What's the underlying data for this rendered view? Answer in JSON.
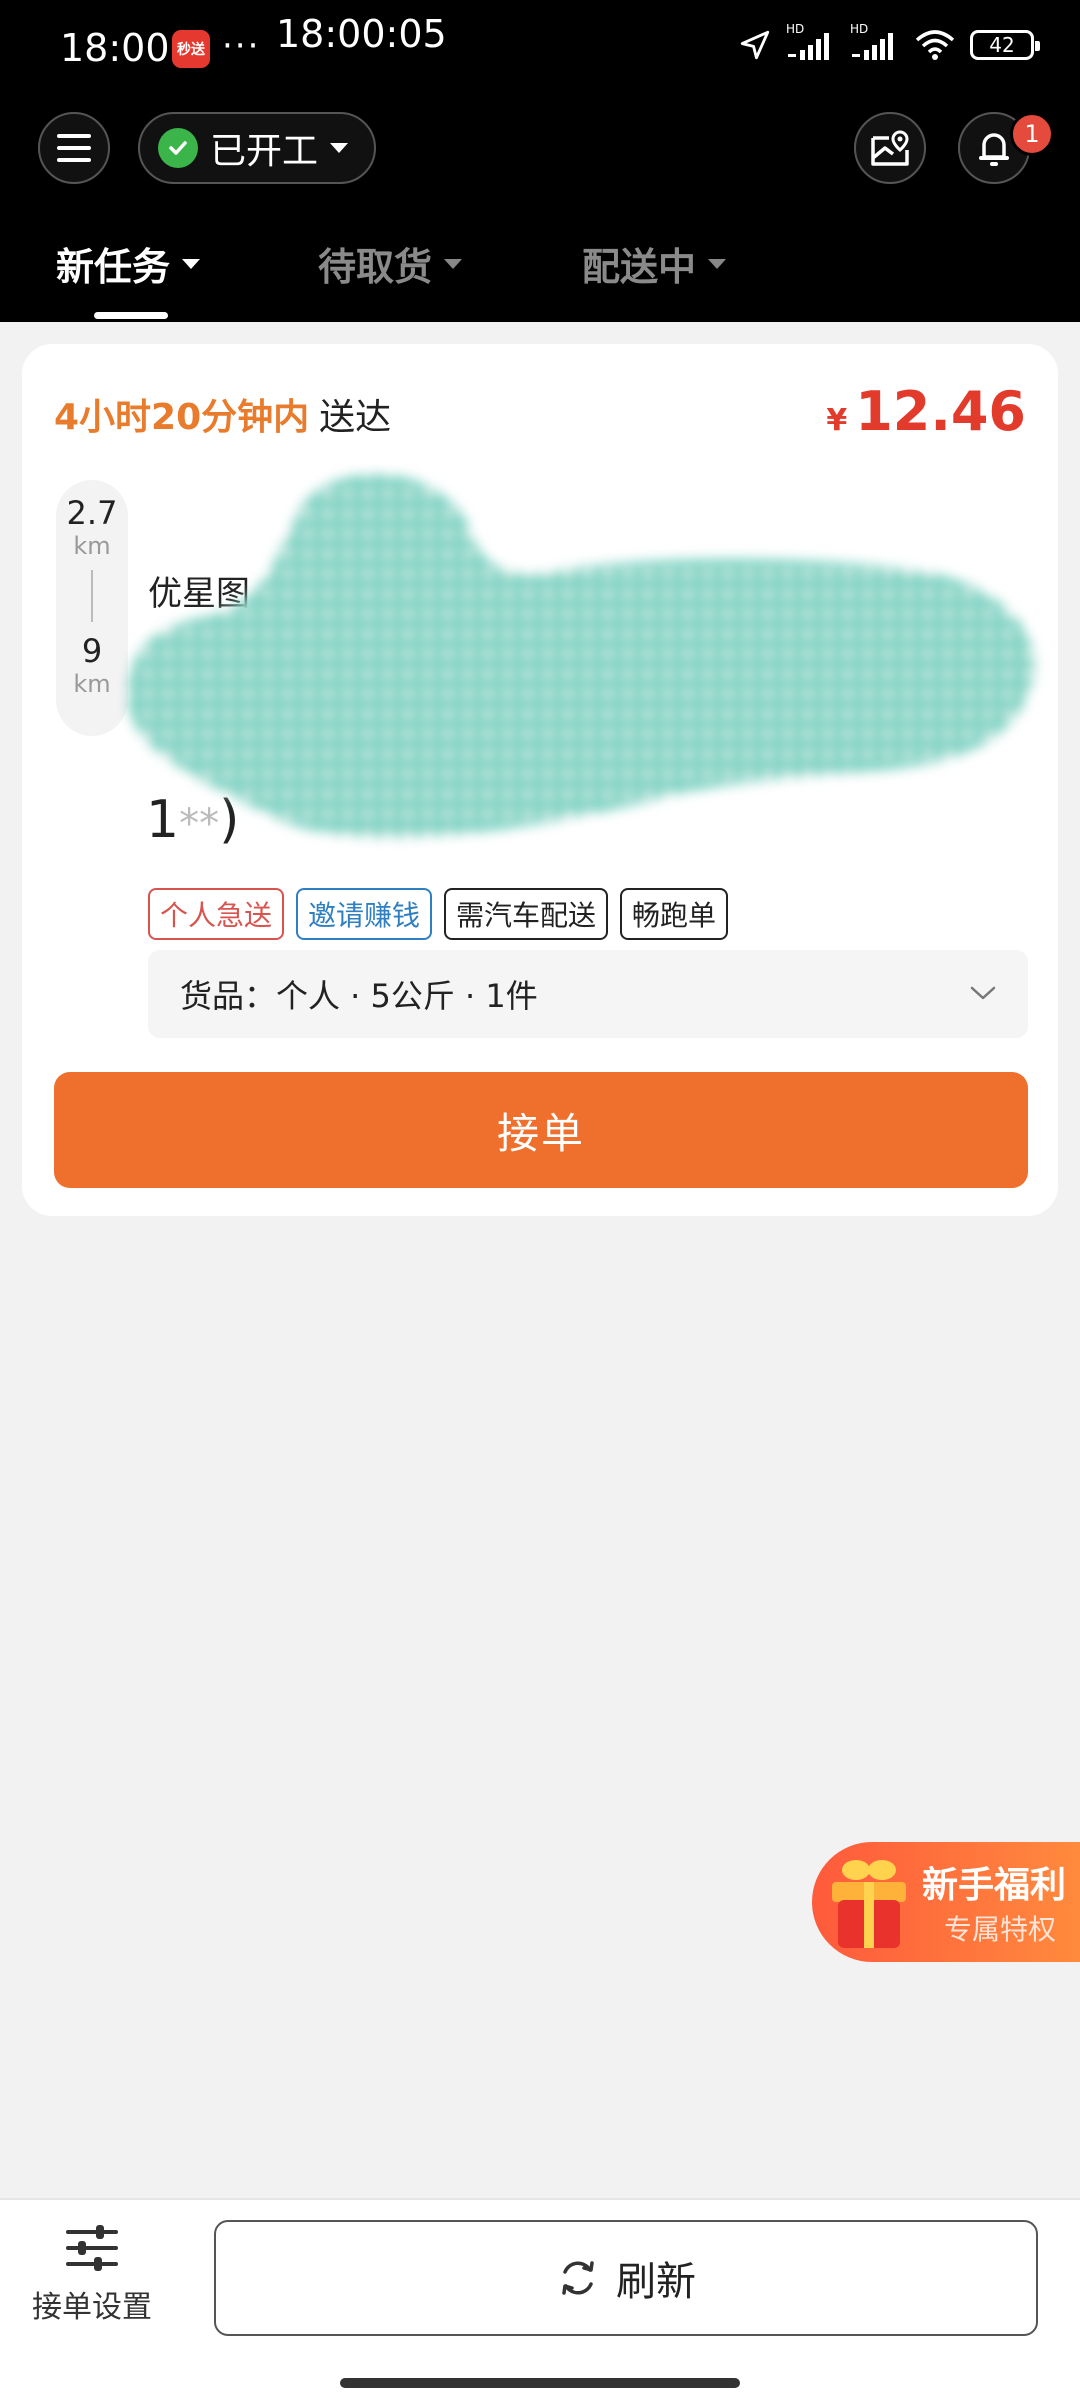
{
  "status_bar": {
    "time": "18:00",
    "app_badge": "秒送",
    "dots": "···",
    "clock": "18:00:05",
    "signal1": "HD",
    "signal2": "HD",
    "battery": "42"
  },
  "header": {
    "work_status": "已开工",
    "notification_count": "1"
  },
  "tabs": [
    {
      "label": "新任务"
    },
    {
      "label": "待取货"
    },
    {
      "label": "配送中"
    }
  ],
  "order": {
    "eta_time": "4小时20分钟内",
    "eta_label": "送达",
    "price_currency": "¥",
    "price": "12.46",
    "pickup_distance": "2.7",
    "pickup_unit": "km",
    "delivery_distance": "9",
    "delivery_unit": "km",
    "pickup_address": "优星图",
    "phone_prefix": "1",
    "phone_mask": "**",
    "phone_suffix": ")",
    "tags": [
      "个人急送",
      "邀请赚钱",
      "需汽车配送",
      "畅跑单"
    ],
    "goods": "货品：个人 · 5公斤 · 1件",
    "accept_label": "接单"
  },
  "promo": {
    "title": "新手福利",
    "subtitle": "专属特权"
  },
  "bottom": {
    "settings_label": "接单设置",
    "refresh_label": "刷新"
  },
  "colors": {
    "accent": "#ef6f2d",
    "price": "#e33b2b",
    "eta": "#e87c2c",
    "active_status": "#3bb54a"
  }
}
